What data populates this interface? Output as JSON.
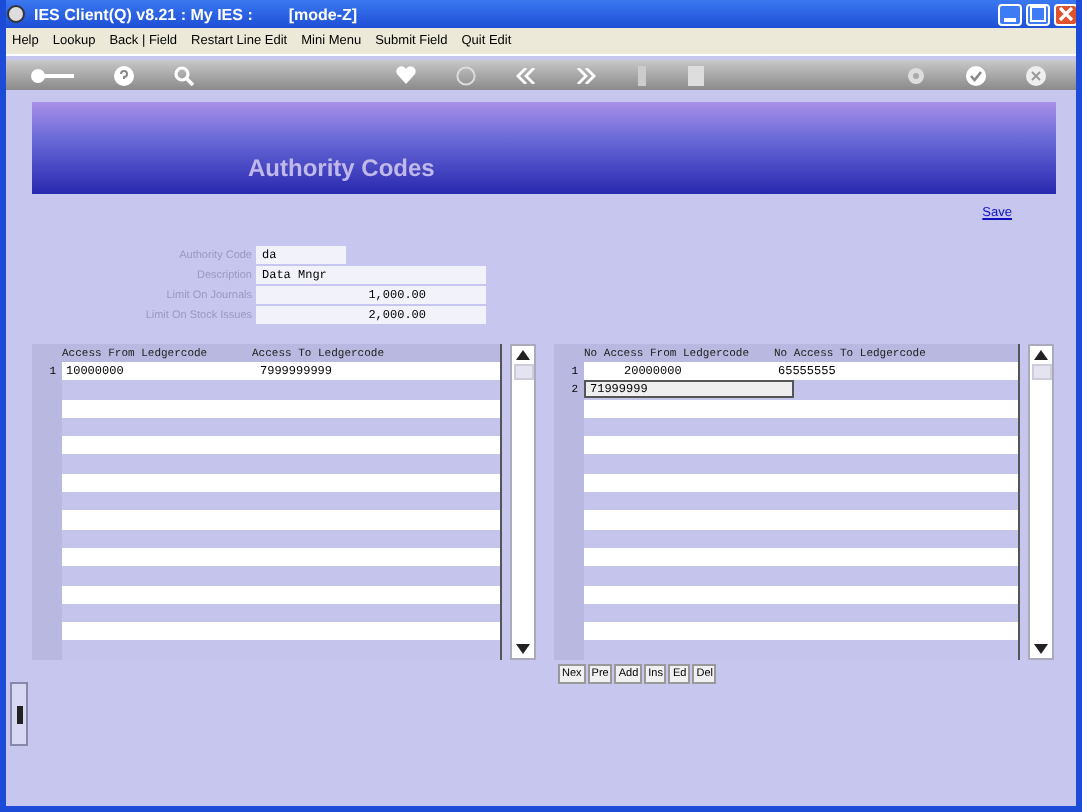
{
  "window": {
    "title": "IES Client(Q) v8.21 : My IES :",
    "mode": "[mode-Z]"
  },
  "menu": [
    "Help",
    "Lookup",
    "Back | Field",
    "Restart Line Edit",
    "Mini Menu",
    "Submit Field",
    "Quit Edit"
  ],
  "banner": {
    "title": "Authority Codes"
  },
  "save_link": "Save",
  "fields": [
    {
      "label": "Authority Code",
      "value": "da",
      "kind": "code"
    },
    {
      "label": "Description",
      "value": "Data Mngr",
      "kind": "text"
    },
    {
      "label": "Limit On Journals",
      "value": "1,000.00",
      "kind": "amount"
    },
    {
      "label": "Limit On Stock Issues",
      "value": "2,000.00",
      "kind": "amount"
    }
  ],
  "left_grid": {
    "columns": [
      "Access From Ledgercode",
      "Access  To  Ledgercode"
    ],
    "rows": [
      {
        "number": "1",
        "cells": [
          "10000000",
          "7999999999"
        ],
        "editing": false
      }
    ]
  },
  "right_grid": {
    "columns": [
      "No Access From Ledgercode",
      "No Access  To  Ledgercode"
    ],
    "rows": [
      {
        "number": "1",
        "cells": [
          "20000000",
          "65555555"
        ],
        "editing": false
      },
      {
        "number": "2",
        "cells": [
          "71999999",
          ""
        ],
        "editing": true
      }
    ]
  },
  "grid_buttons": [
    "Nex",
    "Pre",
    "Add",
    "Ins",
    "Ed",
    "Del"
  ]
}
